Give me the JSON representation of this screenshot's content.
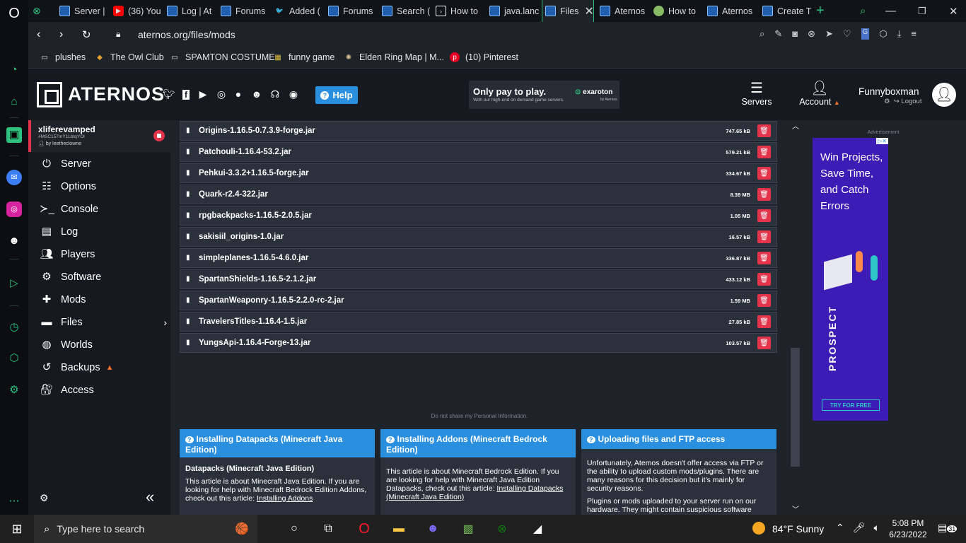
{
  "browser": {
    "tabs": [
      {
        "label": "Server |",
        "icon": "aternos-icon"
      },
      {
        "label": "(36) You",
        "icon": "youtube-icon"
      },
      {
        "label": "Log | At",
        "icon": "aternos-icon"
      },
      {
        "label": "Forums",
        "icon": "aternos-icon"
      },
      {
        "label": "Added (",
        "icon": "bird-icon"
      },
      {
        "label": "Forums",
        "icon": "aternos-icon"
      },
      {
        "label": "Search (",
        "icon": "aternos-icon"
      },
      {
        "label": "How to",
        "icon": "terminal-icon"
      },
      {
        "label": "java.lanc",
        "icon": "aternos-icon"
      },
      {
        "label": "Files",
        "icon": "aternos-icon",
        "active": true
      },
      {
        "label": "Aternos",
        "icon": "aternos-icon"
      },
      {
        "label": "How to",
        "icon": "green-circle-icon"
      },
      {
        "label": "Aternos",
        "icon": "aternos-icon"
      },
      {
        "label": "Create T",
        "icon": "aternos-icon"
      }
    ],
    "url": "aternos.org/files/mods",
    "bookmarks": [
      {
        "label": "plushes",
        "icon": "folder-icon"
      },
      {
        "label": "The Owl Club",
        "icon": "folder-icon"
      },
      {
        "label": "SPAMTON COSTUME",
        "icon": "folder-icon"
      },
      {
        "label": "funny game",
        "icon": "game-icon"
      },
      {
        "label": "Elden Ring Map | M...",
        "icon": "map-icon"
      },
      {
        "label": "(10) Pinterest",
        "icon": "pinterest-icon"
      }
    ]
  },
  "header": {
    "logo": "ATERNOS",
    "help": "Help",
    "ad_headline": "Only pay to play.",
    "ad_sub": "With our high-end on demand game servers.",
    "ad_brand": "exaroton",
    "ad_brand_sub": "by Aternos",
    "nav_servers": "Servers",
    "nav_account": "Account",
    "username": "Funnyboxman",
    "logout": "Logout"
  },
  "sidebar": {
    "server_name": "xliferevamped",
    "server_id": "#MSC157mY1LbtqYOl",
    "server_by": "by leetheclowne",
    "items": [
      {
        "label": "Server",
        "icon": "power-icon"
      },
      {
        "label": "Options",
        "icon": "sliders-icon"
      },
      {
        "label": "Console",
        "icon": "terminal-icon"
      },
      {
        "label": "Log",
        "icon": "file-icon"
      },
      {
        "label": "Players",
        "icon": "users-icon"
      },
      {
        "label": "Software",
        "icon": "cogs-icon"
      },
      {
        "label": "Mods",
        "icon": "puzzle-icon"
      },
      {
        "label": "Files",
        "icon": "folder-icon"
      },
      {
        "label": "Worlds",
        "icon": "globe-icon"
      },
      {
        "label": "Backups",
        "icon": "history-icon"
      },
      {
        "label": "Access",
        "icon": "user-lock-icon"
      }
    ]
  },
  "files": [
    {
      "name": "Origins-1.16.5-0.7.3.9-forge.jar",
      "size": "747.65 kB"
    },
    {
      "name": "Patchouli-1.16.4-53.2.jar",
      "size": "579.21 kB"
    },
    {
      "name": "Pehkui-3.3.2+1.16.5-forge.jar",
      "size": "334.67 kB"
    },
    {
      "name": "Quark-r2.4-322.jar",
      "size": "8.39 MB"
    },
    {
      "name": "rpgbackpacks-1.16.5-2.0.5.jar",
      "size": "1.05 MB"
    },
    {
      "name": "sakisiil_origins-1.0.jar",
      "size": "16.57 kB"
    },
    {
      "name": "simpleplanes-1.16.5-4.6.0.jar",
      "size": "336.87 kB"
    },
    {
      "name": "SpartanShields-1.16.5-2.1.2.jar",
      "size": "433.12 kB"
    },
    {
      "name": "SpartanWeaponry-1.16.5-2.2.0-rc-2.jar",
      "size": "1.59 MB"
    },
    {
      "name": "TravelersTitles-1.16.4-1.5.jar",
      "size": "27.85 kB"
    },
    {
      "name": "YungsApi-1.16.4-Forge-13.jar",
      "size": "103.57 kB"
    }
  ],
  "privacy": "Do not share my Personal Information.",
  "cards": [
    {
      "title": "Installing Datapacks (Minecraft Java Edition)",
      "subtitle": "Datapacks (Minecraft Java Edition)",
      "body": "This article is about Minecraft Java Edition. If you are looking for help with Minecraft Bedrock Edition Addons, check out this article: ",
      "link": "Installing Addons"
    },
    {
      "title": "Installing Addons (Minecraft Bedrock Edition)",
      "subtitle": "",
      "body": "This article is about Minecraft Bedrock Edition. If you are looking for help with Minecraft Java Edition Datapacks, check out this article: ",
      "link": "Installing Datapacks (Minecraft Java Edition)"
    },
    {
      "title": "Uploading files and FTP access",
      "subtitle": "",
      "body": "Unfortunately, Atemos doesn't offer access via FTP or the ability to upload custom mods/plugins. There are many reasons for this decision but it's mainly for security reasons.",
      "body2": "Plugins or mods uploaded to your server run on our hardware. They might contain suspicious software",
      "link": ""
    }
  ],
  "side_ad": {
    "label": "Advertisement",
    "text": "Win Projects, Save Time, and Catch Errors",
    "brand": "PROSPECT",
    "cta": "TRY FOR FREE"
  },
  "taskbar": {
    "search_placeholder": "Type here to search",
    "weather": "84°F  Sunny",
    "time": "5:08 PM",
    "date": "6/23/2022",
    "notif": "31"
  },
  "colors": {
    "accent": "#2b8fe0",
    "danger": "#e3344b",
    "opera_green": "#2ec27e"
  }
}
